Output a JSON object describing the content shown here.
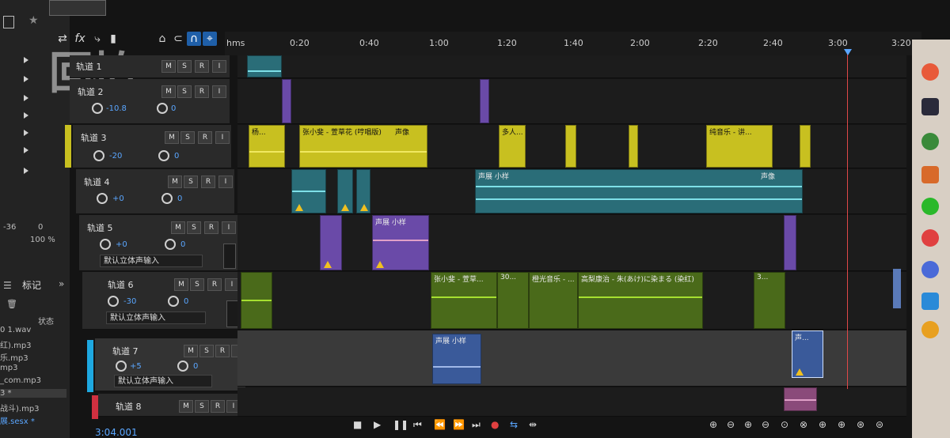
{
  "watermark": "回拍",
  "ruler": {
    "ticks": [
      "hms",
      "0:20",
      "0:40",
      "1:00",
      "1:20",
      "1:40",
      "2:00",
      "2:20",
      "2:40",
      "3:00",
      "3:20"
    ]
  },
  "left_panel": {
    "meter_labels": [
      "-36",
      "0",
      "100 %"
    ],
    "markers_tab": "标记",
    "status_header": "状态",
    "files": [
      "0 1.wav",
      "红).mp3",
      "乐.mp3",
      "mp3",
      "_com.mp3",
      "3 *",
      "战斗).mp3",
      "展.sesx *"
    ]
  },
  "colors": {
    "yellow": "#d8d020",
    "cyan": "#52c8d0",
    "purple": "#8a5fc8",
    "green": "#9ad028",
    "blue": "#6080c8",
    "pink": "#e0a0c8",
    "accent": "#1f5fa8"
  },
  "tracks": [
    {
      "name": "轨道 1",
      "vol": "",
      "pan": "",
      "input": ""
    },
    {
      "name": "轨道 2",
      "vol": "-10.8",
      "pan": "0",
      "input": ""
    },
    {
      "name": "轨道 3",
      "vol": "-20",
      "pan": "0",
      "input": ""
    },
    {
      "name": "轨道 4",
      "vol": "+0",
      "pan": "0",
      "input": ""
    },
    {
      "name": "轨道 5",
      "vol": "+0",
      "pan": "0",
      "input": "默认立体声输入"
    },
    {
      "name": "轨道 6",
      "vol": "-30",
      "pan": "0",
      "input": "默认立体声输入"
    },
    {
      "name": "轨道 7",
      "vol": "+5",
      "pan": "0",
      "input": "默认立体声输入"
    },
    {
      "name": "轨道 8",
      "vol": "",
      "pan": "",
      "input": ""
    }
  ],
  "clips": {
    "t3": [
      "杨...",
      "张小斐 - 萱草花 (哼唱版)",
      "声像",
      "多人...",
      "纯音乐 - 讲..."
    ],
    "t4": [
      "声展 小样",
      "声像"
    ],
    "t5": [
      "声展 小样"
    ],
    "t6": [
      "张小斐 - 萱草...",
      "30...",
      "橙光音乐 - ...",
      "高梨康治 - 朱(あけ)に染まる (染红)",
      "3..."
    ],
    "t7": [
      "声展 小样",
      "声..."
    ]
  },
  "transport": {
    "timecode": "3:04.001"
  }
}
